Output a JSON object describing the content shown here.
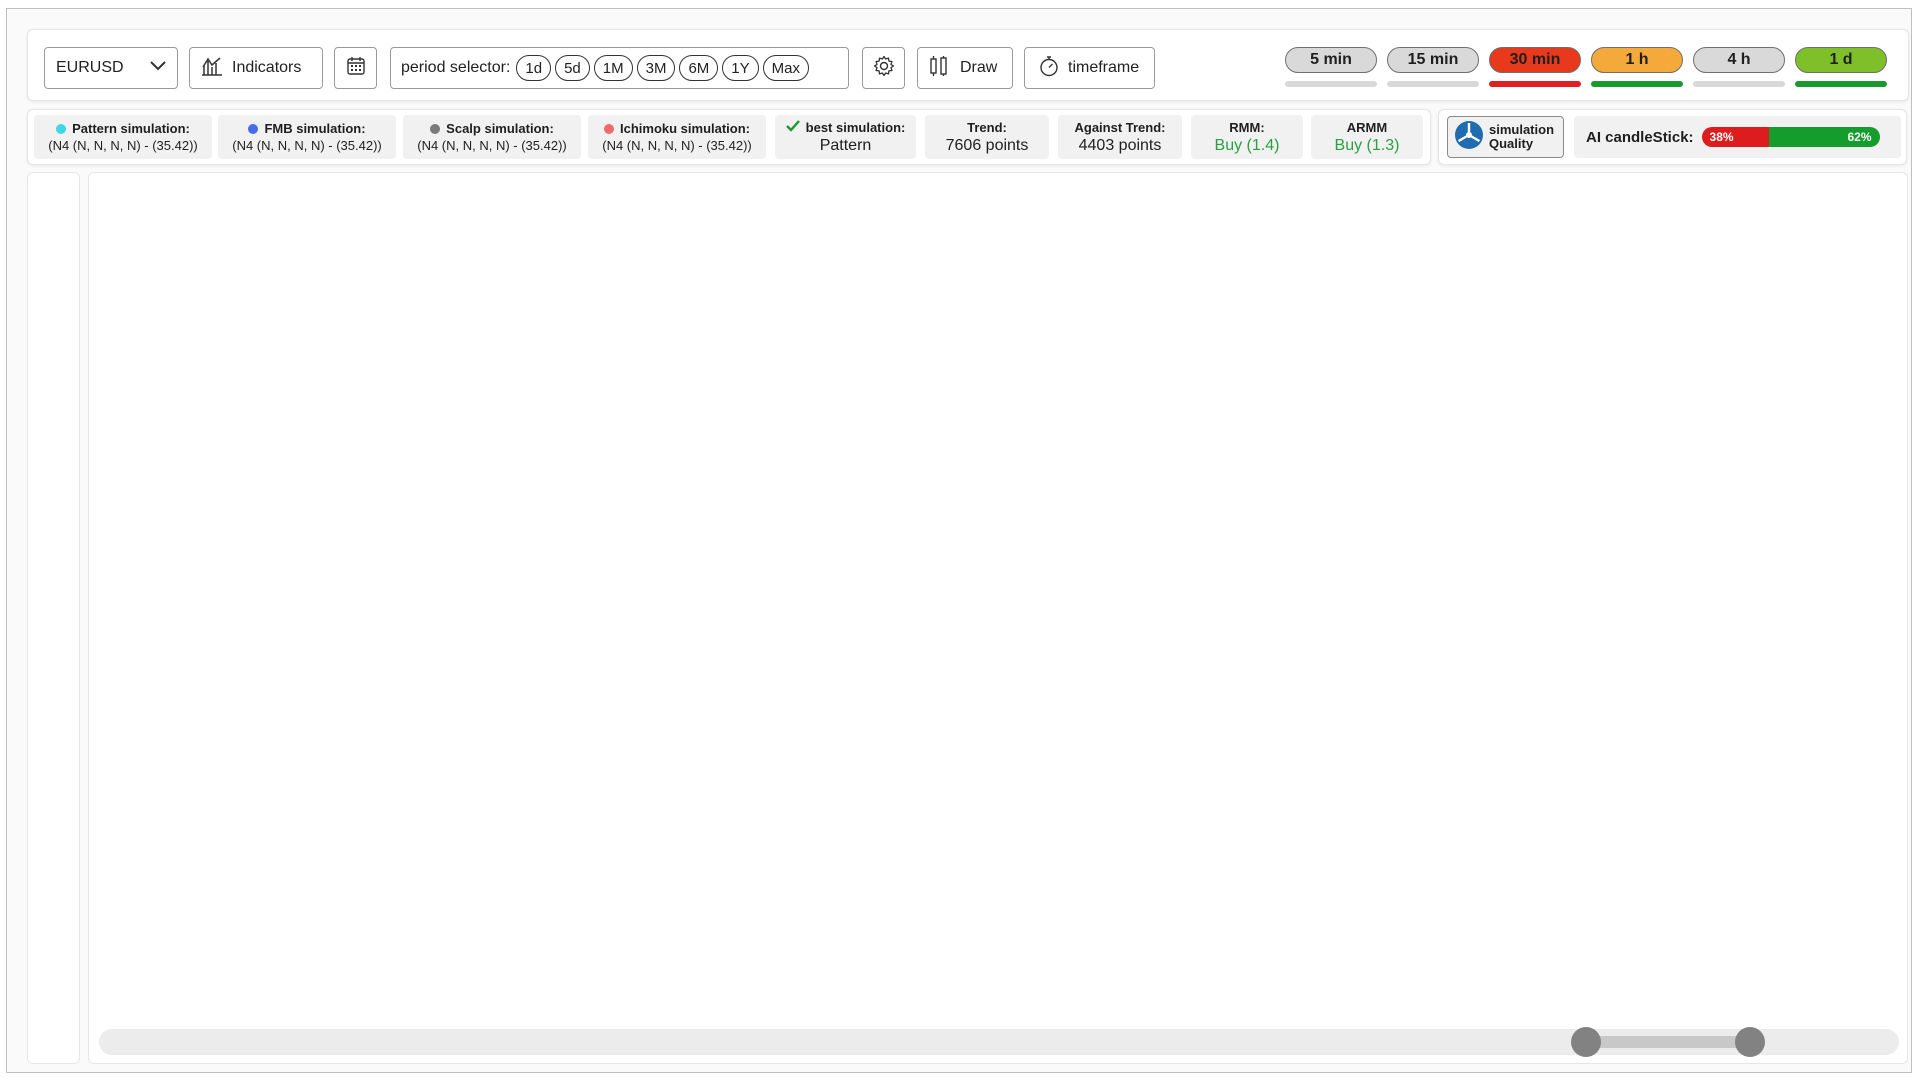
{
  "toolbar": {
    "symbol": "EURUSD",
    "indicators_label": "Indicators",
    "period_label": "period selector:",
    "periods": [
      "1d",
      "5d",
      "1M",
      "3M",
      "6M",
      "1Y",
      "Max"
    ],
    "draw_label": "Draw",
    "timeframe_label": "timeframe",
    "timeframes": [
      {
        "label": "5 min",
        "pill_color": "#d9d9d9",
        "bar_color": "#d9d9d9"
      },
      {
        "label": "15 min",
        "pill_color": "#d9d9d9",
        "bar_color": "#d9d9d9"
      },
      {
        "label": "30 min",
        "pill_color": "#e8391c",
        "bar_color": "#e01e24"
      },
      {
        "label": "1 h",
        "pill_color": "#f5a93a",
        "bar_color": "#1a9a2e"
      },
      {
        "label": "4 h",
        "pill_color": "#d9d9d9",
        "bar_color": "#d9d9d9"
      },
      {
        "label": "1 d",
        "pill_color": "#7fc02a",
        "bar_color": "#1a9a2e"
      }
    ]
  },
  "simulations": [
    {
      "name": "Pattern simulation:",
      "value": "(N4 (N, N, N, N) - (35.42))",
      "dot_color": "#3fd6e6"
    },
    {
      "name": "FMB simulation:",
      "value": "(N4 (N, N, N, N) - (35.42))",
      "dot_color": "#4a6be8"
    },
    {
      "name": "Scalp simulation:",
      "value": "(N4 (N, N, N, N) - (35.42))",
      "dot_color": "#7a7a7a"
    },
    {
      "name": "Ichimoku simulation:",
      "value": "(N4 (N, N, N, N) - (35.42))",
      "dot_color": "#f06a6a"
    }
  ],
  "best_simulation": {
    "label": "best simulation:",
    "value": "Pattern"
  },
  "trend": {
    "label": "Trend:",
    "value": "7606 points"
  },
  "against_trend": {
    "label": "Against Trend:",
    "value": "4403 points"
  },
  "rmm": {
    "label": "RMM:",
    "value": "Buy (1.4)"
  },
  "armm": {
    "label": "ARMM",
    "value": "Buy (1.3)"
  },
  "quality": {
    "line1": "simulation",
    "line2": "Quality"
  },
  "ai_candlestick": {
    "label": "AI candleStick:",
    "bear_pct": 38,
    "bull_pct": 62,
    "bear_text": "38%",
    "bull_text": "62%"
  },
  "colors": {
    "positive_text": "#2aa040",
    "bear": "#dd1d1d",
    "bull": "#149c2c"
  },
  "range_slider": {
    "start_fraction": 0.826,
    "end_fraction": 0.917
  }
}
